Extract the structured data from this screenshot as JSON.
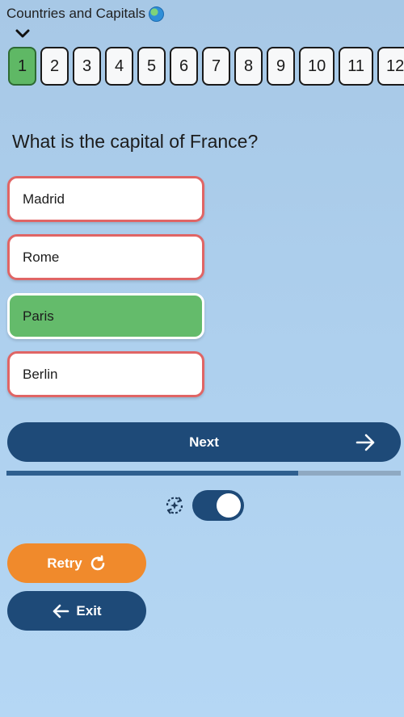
{
  "app": {
    "title": "Countries and Capitals"
  },
  "question_nav": {
    "active_index": 0,
    "items": [
      "1",
      "2",
      "3",
      "4",
      "5",
      "6",
      "7",
      "8",
      "9",
      "10",
      "11",
      "12"
    ]
  },
  "question": {
    "text": "What is the capital of France?"
  },
  "answers": [
    {
      "label": "Madrid",
      "state": "incorrect"
    },
    {
      "label": "Rome",
      "state": "incorrect"
    },
    {
      "label": "Paris",
      "state": "correct"
    },
    {
      "label": "Berlin",
      "state": "incorrect"
    }
  ],
  "next_button": {
    "label": "Next",
    "icon": "arrow-right-icon"
  },
  "progress": {
    "fraction": 0.74
  },
  "auto_advance": {
    "icon": "auto-advance-icon",
    "enabled": true
  },
  "retry_button": {
    "label": "Retry",
    "icon": "refresh-icon"
  },
  "exit_button": {
    "label": "Exit",
    "icon": "arrow-left-icon"
  },
  "colors": {
    "primary": "#1e4a78",
    "correct": "#64bb6b",
    "incorrect_border": "#e06565",
    "retry": "#f08a2c"
  }
}
